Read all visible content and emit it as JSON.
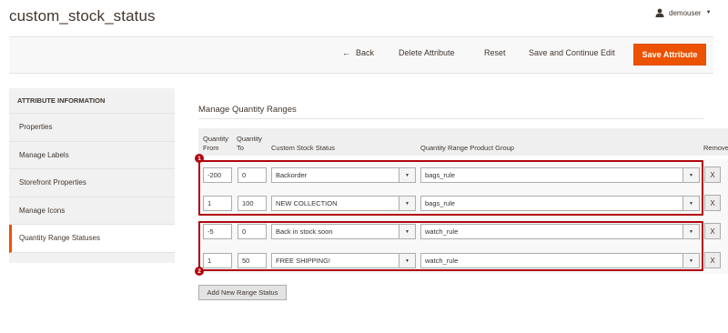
{
  "header": {
    "title": "custom_stock_status",
    "user": "demouser"
  },
  "actions": {
    "back": "Back",
    "delete": "Delete Attribute",
    "reset": "Reset",
    "save_continue": "Save and Continue Edit",
    "save": "Save Attribute"
  },
  "sidebar": {
    "title": "ATTRIBUTE INFORMATION",
    "items": [
      {
        "label": "Properties",
        "active": false
      },
      {
        "label": "Manage Labels",
        "active": false
      },
      {
        "label": "Storefront Properties",
        "active": false
      },
      {
        "label": "Manage Icons",
        "active": false
      },
      {
        "label": "Quantity Range Statuses",
        "active": true
      }
    ]
  },
  "section": {
    "title": "Manage Quantity Ranges",
    "columns": {
      "qty_from_1": "Quantity",
      "qty_from_2": "From",
      "qty_to_1": "Quantity",
      "qty_to_2": "To",
      "status": "Custom Stock Status",
      "group": "Quantity Range Product Group",
      "remove": "Remove"
    },
    "rows": [
      {
        "from": "-200",
        "to": "0",
        "status": "Backorder",
        "group": "bags_rule",
        "remove": "X"
      },
      {
        "from": "1",
        "to": "100",
        "status": "NEW COLLECTION",
        "group": "bags_rule",
        "remove": "X"
      },
      {
        "from": "-5",
        "to": "0",
        "status": "Back in stock soon",
        "group": "watch_rule",
        "remove": "X"
      },
      {
        "from": "1",
        "to": "50",
        "status": "FREE SHIPPING!",
        "group": "watch_rule",
        "remove": "X"
      }
    ],
    "add_button": "Add New Range Status"
  },
  "annotations": {
    "group1": "1",
    "group2": "2",
    "color": "#b1060e"
  },
  "colors": {
    "accent": "#eb5202",
    "annotation": "#b1060e"
  }
}
